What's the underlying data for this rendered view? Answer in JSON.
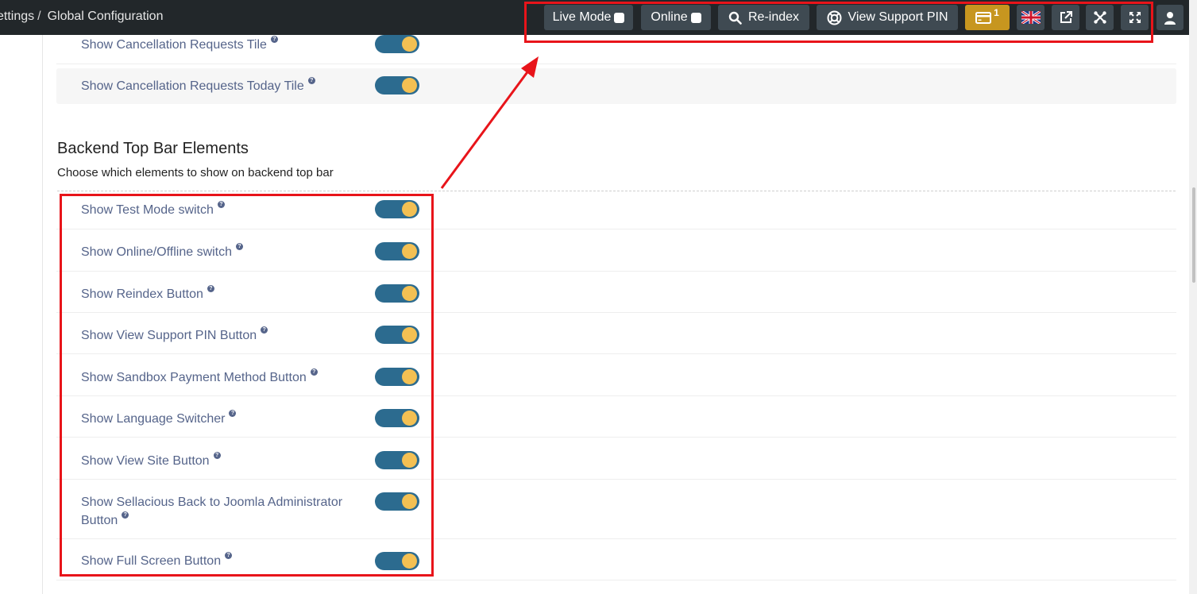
{
  "breadcrumb": {
    "parent": "ettings",
    "separator": "/",
    "current": "Global Configuration"
  },
  "topbar": {
    "live_mode_label": "Live Mode",
    "online_label": "Online",
    "reindex_label": "Re-index",
    "support_pin_label": "View Support PIN",
    "payment_badge": "1",
    "icons": [
      "search-icon",
      "lifebuoy-icon",
      "credit-card-icon",
      "uk-flag-icon",
      "external-link-icon",
      "joomla-icon",
      "fullscreen-icon",
      "user-icon"
    ]
  },
  "top_rows": [
    {
      "label": "Show Cancellation Requests Tile",
      "enabled": true
    },
    {
      "label": "Show Cancellation Requests Today Tile",
      "enabled": true
    }
  ],
  "section": {
    "title": "Backend Top Bar Elements",
    "description": "Choose which elements to show on backend top bar"
  },
  "settings": [
    {
      "label": "Show Test Mode switch",
      "enabled": true
    },
    {
      "label": "Show Online/Offline switch",
      "enabled": true
    },
    {
      "label": "Show Reindex Button",
      "enabled": true
    },
    {
      "label": "Show View Support PIN Button",
      "enabled": true
    },
    {
      "label": "Show Sandbox Payment Method Button",
      "enabled": true
    },
    {
      "label": "Show Language Switcher",
      "enabled": true
    },
    {
      "label": "Show View Site Button",
      "enabled": true
    },
    {
      "label": "Show Sellacious Back to Joomla Administrator Button",
      "enabled": true
    },
    {
      "label": "Show Full Screen Button",
      "enabled": true
    }
  ],
  "colors": {
    "topbar_bg": "#22272a",
    "button_bg": "#3f4a52",
    "card_button_bg": "#c7961f",
    "toggle_track": "#2c6b8f",
    "toggle_knob": "#f3c053",
    "label_text": "#55648a",
    "annotation_red": "#e8141a"
  }
}
